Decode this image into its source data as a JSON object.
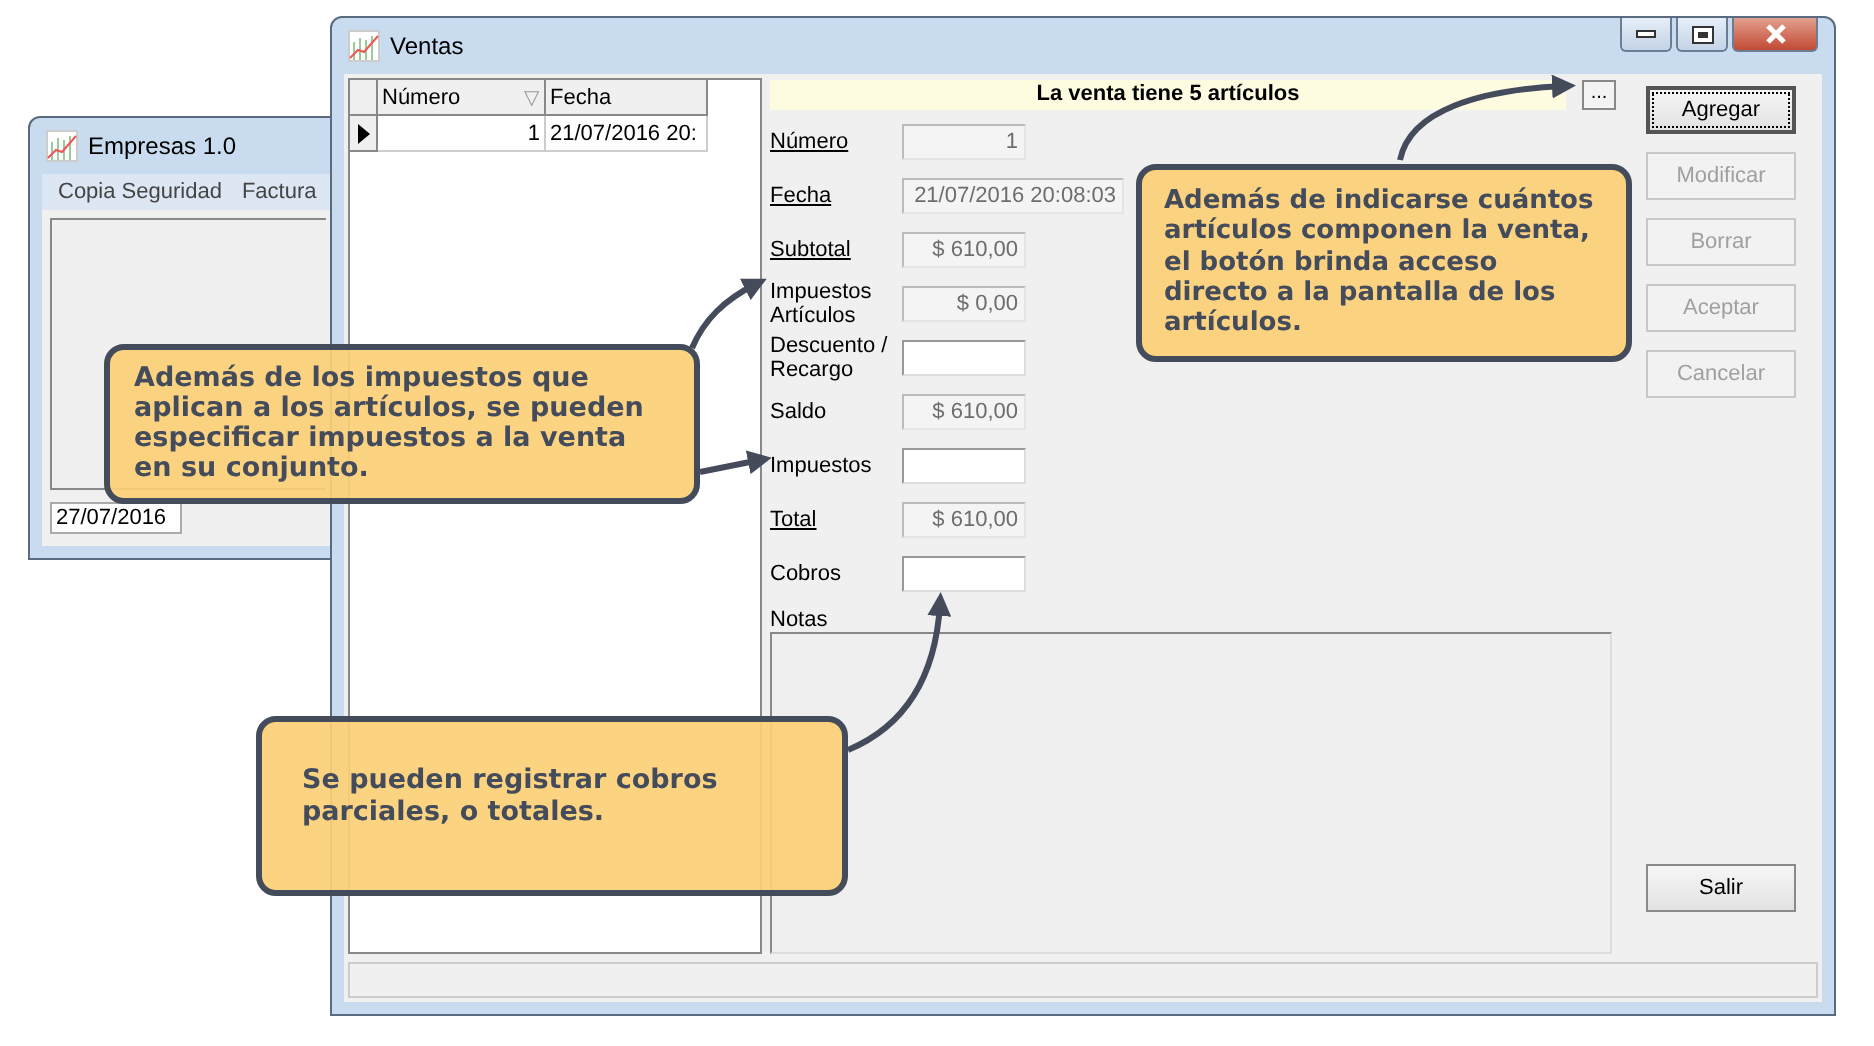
{
  "back_window": {
    "title": "Empresas 1.0",
    "menu": [
      "Copia Seguridad",
      "Factura"
    ],
    "date_field": "27/07/2016"
  },
  "window": {
    "title": "Ventas",
    "grid": {
      "columns": [
        {
          "label": "Número",
          "sort": "▽"
        },
        {
          "label": "Fecha"
        }
      ],
      "rows": [
        {
          "selected": true,
          "cells": [
            "1",
            "21/07/2016 20:"
          ]
        }
      ]
    },
    "info_bar": {
      "text": "La venta tiene 5 artículos",
      "button": "..."
    },
    "fields": [
      {
        "label": "Número",
        "underlined": true,
        "value": "1",
        "readonly": true,
        "wide": false
      },
      {
        "label": "Fecha",
        "underlined": true,
        "value": "21/07/2016 20:08:03",
        "readonly": true,
        "wide": true
      },
      {
        "label": "Subtotal",
        "underlined": true,
        "value": "$ 610,00",
        "readonly": true,
        "wide": false
      },
      {
        "label": "Impuestos Artículos",
        "underlined": false,
        "value": "$ 0,00",
        "readonly": true,
        "wide": false
      },
      {
        "label": "Descuento / Recargo",
        "underlined": false,
        "readonly": false,
        "wide": false
      },
      {
        "label": "Saldo",
        "underlined": false,
        "value": "$ 610,00",
        "readonly": true,
        "wide": false
      },
      {
        "label": "Impuestos",
        "underlined": false,
        "readonly": false,
        "wide": false
      },
      {
        "label": "Total",
        "underlined": true,
        "value": "$ 610,00",
        "readonly": true,
        "wide": false
      },
      {
        "label": "Cobros",
        "underlined": false,
        "readonly": false,
        "wide": false
      }
    ],
    "notes_label": "Notas",
    "buttons": [
      {
        "label": "Agregar",
        "disabled": false,
        "default": true
      },
      {
        "label": "Modificar",
        "disabled": true,
        "default": false
      },
      {
        "label": "Borrar",
        "disabled": true,
        "default": false
      },
      {
        "label": "Aceptar",
        "disabled": true,
        "default": false
      },
      {
        "label": "Cancelar",
        "disabled": true,
        "default": false
      }
    ],
    "exit_button": "Salir"
  },
  "callouts": [
    {
      "kind": "top",
      "text": "Además de indicarse cuántos artículos componen la venta, el botón brinda acceso directo a la pantalla de los artículos."
    },
    {
      "kind": "left",
      "text": "Además de los impuestos que aplican a los artículos, se pueden especificar impuestos a la venta en su conjunto."
    },
    {
      "kind": "bottom",
      "text": "Se pueden registrar cobros parciales, o totales."
    }
  ]
}
